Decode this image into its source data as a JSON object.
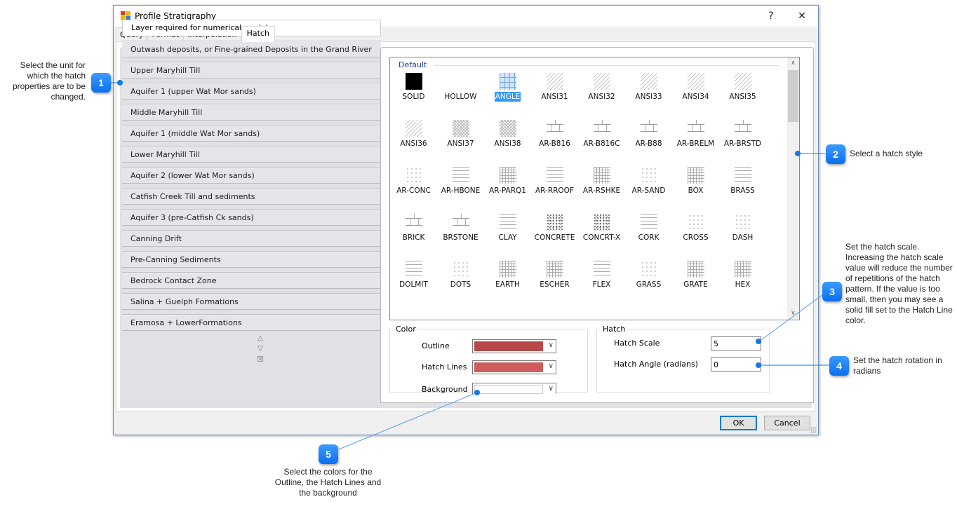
{
  "window": {
    "title": "Profile Stratigraphy",
    "help_label": "?",
    "close_label": "✕"
  },
  "tabs": [
    {
      "label": "Query",
      "active": false
    },
    {
      "label": "Format",
      "active": false
    },
    {
      "label": "Interpolation",
      "active": false
    },
    {
      "label": "Hatch",
      "active": true
    }
  ],
  "units": {
    "header": "Layer required for numerical model",
    "items": [
      "Outwash deposits, or Fine-grained Deposits in the Grand River valley",
      "Upper Maryhill Till",
      "Aquifer 1 (upper Wat Mor sands)",
      "Middle Maryhill Till",
      "Aquifer 1 (middle Wat Mor sands)",
      "Lower Maryhill Till",
      "Aquifer 2 (lower Wat Mor sands)",
      "Catfish Creek Till and sediments",
      "Aquifer 3 (pre-Catfish Ck sands)",
      "Canning Drift",
      "Pre-Canning Sediments",
      "Bedrock Contact Zone",
      "Salina + Guelph Formations",
      "Eramosa + LowerFormations"
    ],
    "controls": {
      "up": "△",
      "down": "▽",
      "delete": "☒"
    }
  },
  "hatch_list": {
    "group": "Default",
    "selected": "ANGLE",
    "items": [
      "SOLID",
      "HOLLOW",
      "ANGLE",
      "ANSI31",
      "ANSI32",
      "ANSI33",
      "ANSI34",
      "ANSI35",
      "ANSI36",
      "ANSI37",
      "ANSI38",
      "AR-B816",
      "AR-B816C",
      "AR-B88",
      "AR-BRELM",
      "AR-BRSTD",
      "AR-CONC",
      "AR-HBONE",
      "AR-PARQ1",
      "AR-RROOF",
      "AR-RSHKE",
      "AR-SAND",
      "BOX",
      "BRASS",
      "BRICK",
      "BRSTONE",
      "CLAY",
      "CONCRETE",
      "CONCRT-X",
      "CORK",
      "CROSS",
      "DASH",
      "DOLMIT",
      "DOTS",
      "EARTH",
      "ESCHER",
      "FLEX",
      "GRASS",
      "GRATE",
      "HEX",
      "",
      "",
      "",
      "",
      "",
      "",
      "",
      ""
    ],
    "scroll_up": "ⱏ",
    "scroll_down": "∨"
  },
  "color_group": {
    "legend": "Color",
    "outline": {
      "label": "Outline",
      "color": "#b84848"
    },
    "hatch_lines": {
      "label": "Hatch Lines",
      "color": "#cd5c5c"
    },
    "background": {
      "label": "Background",
      "color": "#ffffff"
    },
    "dropdown_glyph": "∨"
  },
  "hatch_group": {
    "legend": "Hatch",
    "scale": {
      "label": "Hatch Scale",
      "value": "5"
    },
    "angle": {
      "label": "Hatch Angle (radians)",
      "value": "0"
    }
  },
  "buttons": {
    "ok": "OK",
    "cancel": "Cancel"
  },
  "callouts": [
    {
      "num": "1",
      "text": "Select the unit for which the hatch properties are to be changed."
    },
    {
      "num": "2",
      "text": "Select a hatch style"
    },
    {
      "num": "3",
      "text": "Set the hatch scale. Increasing the hatch scale value will reduce the number of repetitions of the hatch pattern.  If the value is too small, then you may see a solid fill set to the Hatch Line color."
    },
    {
      "num": "4",
      "text": "Set the hatch rotation in radians"
    },
    {
      "num": "5",
      "text": "Select the colors for the Outline, the Hatch Lines and the background"
    }
  ]
}
